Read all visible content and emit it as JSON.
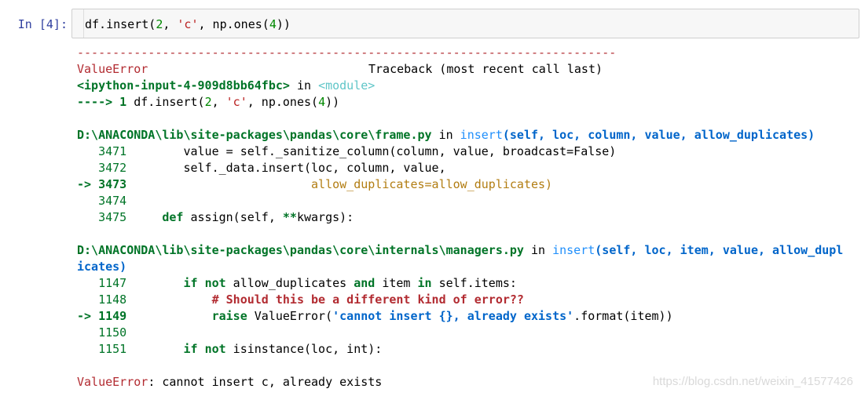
{
  "cell": {
    "prompt": "In  [4]:",
    "code_parts": [
      "df.insert(",
      "2",
      ", ",
      "'c'",
      ", np.ones(",
      "4",
      "))"
    ]
  },
  "traceback": {
    "separator": "----------------------------------------------------------------------------",
    "error_name": "ValueError",
    "header_right": "Traceback (most recent call last)",
    "frame1": {
      "file": "<ipython-input-4-909d8bb64fbc>",
      "in": " in ",
      "func": "<module>",
      "arrow": "----> 1 ",
      "code_a": "df.insert(",
      "code_num": "2",
      "code_b": ", ",
      "code_str": "'c'",
      "code_c": ", np.ones(",
      "code_num2": "4",
      "code_d": "))"
    },
    "frame2": {
      "file": "D:\\ANACONDA\\lib\\site-packages\\pandas\\core\\frame.py",
      "in": " in ",
      "func": "insert",
      "args": "(self, loc, column, value, allow_duplicates)",
      "lines": [
        {
          "num": "   3471",
          "code": "        value = self._sanitize_column(column, value, broadcast=False)"
        },
        {
          "num": "   3472",
          "code": "        self._data.insert(loc, column, value,"
        },
        {
          "num": "-> 3473",
          "code": "                          allow_duplicates=allow_duplicates)"
        },
        {
          "num": "   3474",
          "code": ""
        },
        {
          "num": "   3475",
          "code_kw": "def",
          "code_rest": " assign(self, ",
          "code_op": "**",
          "code_tail": "kwargs):"
        }
      ]
    },
    "frame3": {
      "file": "D:\\ANACONDA\\lib\\site-packages\\pandas\\core\\internals\\managers.py",
      "in": " in ",
      "func": "insert",
      "args_line1": "(self, loc, item, value, allow_dupl",
      "args_line2": "icates)",
      "lines": [
        {
          "num": "   1147",
          "kw1": "if",
          "mid1": " ",
          "kw2": "not",
          "mid2": " allow_duplicates ",
          "kw3": "and",
          "mid3": " item ",
          "kw4": "in",
          "tail": " self.items:"
        },
        {
          "num": "   1148",
          "comment": "# Should this be a different kind of error??"
        },
        {
          "num": "-> 1149",
          "kw": "raise",
          "rest": " ValueError(",
          "str": "'cannot insert {}, already exists'",
          "tail": ".format(item))"
        },
        {
          "num": "   1150",
          "code": ""
        },
        {
          "num": "   1151",
          "kw1": "if",
          "mid": " ",
          "kw2": "not",
          "tail": " isinstance(loc, int):"
        }
      ]
    },
    "final_error_name": "ValueError",
    "final_error_msg": ": cannot insert c, already exists"
  },
  "watermark": "https://blog.csdn.net/weixin_41577426"
}
